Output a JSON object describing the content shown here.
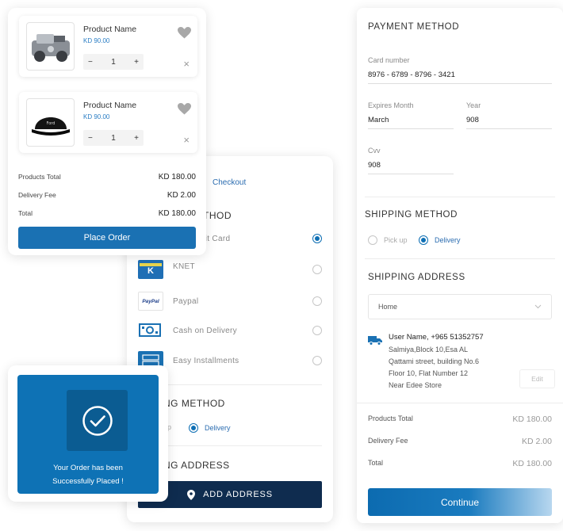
{
  "cart": {
    "items": [
      {
        "name": "Product Name",
        "price": "KD 90.00",
        "quantity": "1",
        "image": "car-parts-image"
      },
      {
        "name": "Product Name",
        "price": "KD 90.00",
        "quantity": "1",
        "image": "black-cap-image"
      }
    ],
    "totals": [
      {
        "label": "Products Total",
        "value": "KD 180.00"
      },
      {
        "label": "Delivery Fee",
        "value": "KD 2.00"
      },
      {
        "label": "Total",
        "value": "KD 180.00"
      }
    ],
    "place_order_label": "Place Order",
    "minus_symbol": "−",
    "plus_symbol": "+",
    "remove_symbol": "×"
  },
  "checkout": {
    "breadcrumb": "Checkout",
    "payment_section": "THOD",
    "methods": [
      {
        "label": "ard/ Debit Card",
        "selected": true
      },
      {
        "label": "KNET",
        "selected": false,
        "icon": "knet-logo"
      },
      {
        "label": "Paypal",
        "selected": false,
        "icon": "paypal-logo"
      },
      {
        "label": "Cash on Delivery",
        "selected": false,
        "icon": "cash-icon"
      },
      {
        "label": "Easy Installments",
        "selected": false,
        "icon": "installments-icon"
      }
    ],
    "shipping_section": "NG METHOD",
    "shipping_options": [
      {
        "label": "up",
        "selected": false
      },
      {
        "label": "Delivery",
        "selected": true
      }
    ],
    "address_section": "NG ADDRESS",
    "add_address_label": "ADD ADDRESS",
    "logo_texts": {
      "knet": "K",
      "paypal": "PayPal"
    }
  },
  "success": {
    "line1": "Your Order has been",
    "line2": "Successfully Placed !"
  },
  "payment": {
    "title": "PAYMENT METHOD",
    "card_number_label": "Card number",
    "card_number": "8976 - 6789 - 8796 - 3421",
    "expires_month_label": "Expires Month",
    "expires_month": "March",
    "year_label": "Year",
    "year": "908",
    "cvv_label": "Cvv",
    "cvv": "908",
    "shipping_method_title": "SHIPPING METHOD",
    "shipping_options": [
      {
        "label": "Pick up",
        "selected": false
      },
      {
        "label": "Delivery",
        "selected": true
      }
    ],
    "shipping_address_title": "SHIPPING ADDRESS",
    "address_select": "Home",
    "address": {
      "name_line": "User Name, +965 51352757",
      "lines": [
        "Salmiya,Block 10,Esa AL",
        "Qattami street, building No.6",
        "Floor 10, Flat Number 12",
        "Near Edee Store"
      ]
    },
    "edit_label": "Edit",
    "totals": [
      {
        "label": "Products Total",
        "value": "KD 180.00"
      },
      {
        "label": "Delivery Fee",
        "value": "KD 2.00"
      },
      {
        "label": "Total",
        "value": "KD 180.00"
      }
    ],
    "continue_label": "Continue"
  },
  "colors": {
    "primary": "#1a71b3",
    "navy": "#0f2c4f",
    "link": "#2a7dc4"
  }
}
